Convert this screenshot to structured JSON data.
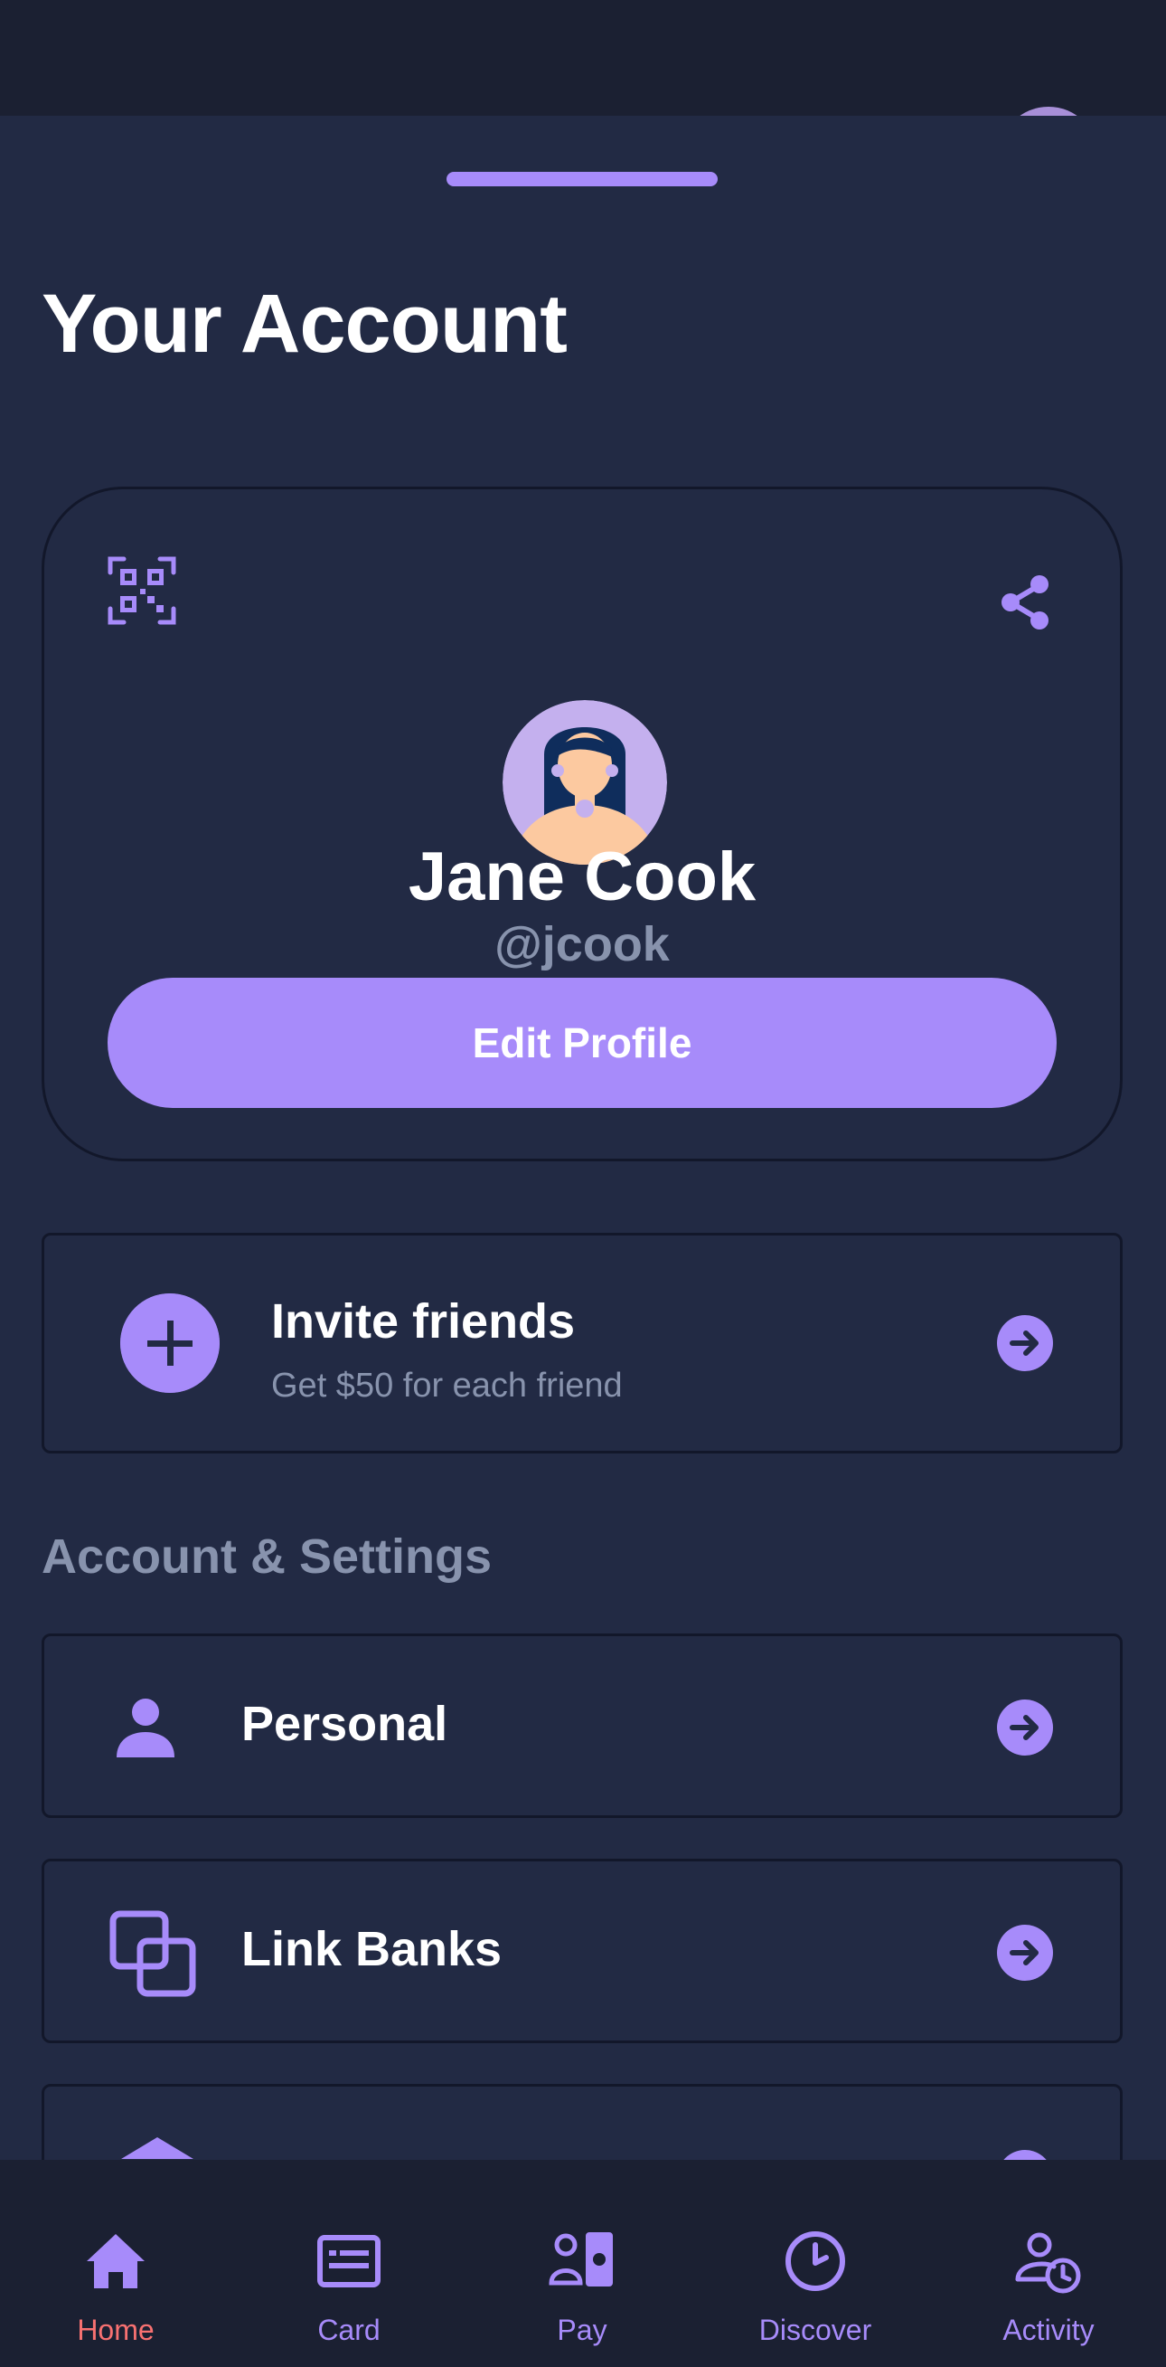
{
  "page": {
    "title": "Your Account"
  },
  "colors": {
    "accent": "#a78bfa",
    "background": "#222a44",
    "active_tab": "#f87171",
    "muted_text": "#8893ad"
  },
  "profile": {
    "name": "Jane Cook",
    "username": "@jcook",
    "edit_label": "Edit Profile",
    "icons": [
      "qr-code-icon",
      "share-icon",
      "avatar"
    ]
  },
  "invite": {
    "title": "Invite friends",
    "subtitle": "Get $50 for each friend",
    "icons": [
      "plus-icon",
      "arrow-right-icon"
    ]
  },
  "settings": {
    "section_title": "Account & Settings",
    "items": [
      {
        "label": "Personal",
        "icon": "person-icon"
      },
      {
        "label": "Link Banks",
        "icon": "link-banks-icon"
      },
      {
        "label": "",
        "icon": "bank-icon"
      }
    ]
  },
  "tabbar": {
    "items": [
      {
        "label": "Home",
        "icon": "home-icon",
        "active": true
      },
      {
        "label": "Card",
        "icon": "card-icon",
        "active": false
      },
      {
        "label": "Pay",
        "icon": "pay-icon",
        "active": false
      },
      {
        "label": "Discover",
        "icon": "clock-icon",
        "active": false
      },
      {
        "label": "Activity",
        "icon": "activity-icon",
        "active": false
      }
    ]
  }
}
